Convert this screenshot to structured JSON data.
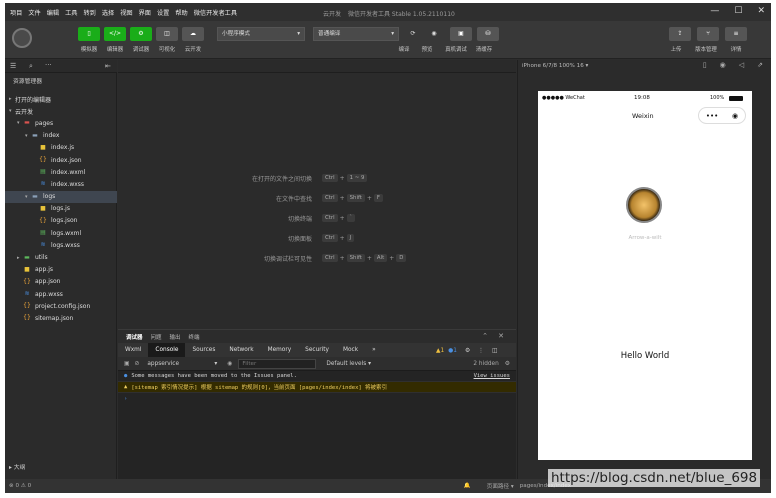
{
  "menu": [
    "项目",
    "文件",
    "编辑",
    "工具",
    "转到",
    "选择",
    "视图",
    "界面",
    "设置",
    "帮助",
    "微信开发者工具"
  ],
  "window_title": [
    "云开发",
    "微信开发者工具 Stable 1.05.2110110"
  ],
  "toolbar": {
    "mode_buttons": [
      "模拟器",
      "编辑器",
      "调试器",
      "可视化",
      "云开发"
    ],
    "compile_mode": "小程序模式",
    "compile_target": "普通编译",
    "actions": [
      "编译",
      "预览",
      "真机调试",
      "清缓存"
    ],
    "right_actions": [
      "上传",
      "版本管理",
      "详情"
    ]
  },
  "sidebar": {
    "header": "资源管理器",
    "sections": [
      "打开的编辑器",
      "云开发"
    ],
    "tree": [
      {
        "label": "pages",
        "indent": 1,
        "type": "folder-red",
        "caret": "▾"
      },
      {
        "label": "index",
        "indent": 2,
        "type": "folder",
        "caret": "▾"
      },
      {
        "label": "index.js",
        "indent": 3,
        "type": "js"
      },
      {
        "label": "index.json",
        "indent": 3,
        "type": "json"
      },
      {
        "label": "index.wxml",
        "indent": 3,
        "type": "wxml"
      },
      {
        "label": "index.wxss",
        "indent": 3,
        "type": "wxss"
      },
      {
        "label": "logs",
        "indent": 2,
        "type": "folder",
        "caret": "▾",
        "selected": true
      },
      {
        "label": "logs.js",
        "indent": 3,
        "type": "js"
      },
      {
        "label": "logs.json",
        "indent": 3,
        "type": "json"
      },
      {
        "label": "logs.wxml",
        "indent": 3,
        "type": "wxml"
      },
      {
        "label": "logs.wxss",
        "indent": 3,
        "type": "wxss"
      },
      {
        "label": "utils",
        "indent": 1,
        "type": "folder-green",
        "caret": "▸"
      },
      {
        "label": "app.js",
        "indent": 1,
        "type": "js"
      },
      {
        "label": "app.json",
        "indent": 1,
        "type": "json"
      },
      {
        "label": "app.wxss",
        "indent": 1,
        "type": "wxss"
      },
      {
        "label": "project.config.json",
        "indent": 1,
        "type": "json"
      },
      {
        "label": "sitemap.json",
        "indent": 1,
        "type": "json"
      }
    ],
    "outline": "大纲",
    "footer": "⊗ 0 ⚠ 0"
  },
  "editor_hints": [
    {
      "label": "在打开的文件之间切换",
      "keys": [
        "Ctrl",
        "1 ~ 9"
      ]
    },
    {
      "label": "在文件中查找",
      "keys": [
        "Ctrl",
        "Shift",
        "F"
      ]
    },
    {
      "label": "切换终端",
      "keys": [
        "Ctrl",
        "`"
      ]
    },
    {
      "label": "切换面板",
      "keys": [
        "Ctrl",
        "J"
      ]
    },
    {
      "label": "切换调试栏可见性",
      "keys": [
        "Ctrl",
        "Shift",
        "Alt",
        "D"
      ]
    }
  ],
  "console": {
    "panel_tabs": [
      "调试器",
      "问题",
      "输出",
      "终端"
    ],
    "devtools_tabs": [
      "Wxml",
      "Console",
      "Sources",
      "Network",
      "Memory",
      "Security",
      "Mock",
      "»"
    ],
    "active_tab": "Console",
    "badges": {
      "warnings": "1",
      "info": "1"
    },
    "context": "appservice",
    "filter_placeholder": "Filter",
    "levels": "Default levels ▾",
    "hidden": "2 hidden",
    "messages": [
      {
        "text": "Some messages have been moved to the Issues panel.",
        "link": "View issues",
        "kind": "info"
      },
      {
        "text": "[sitemap 索引情况提示] 根据 sitemap 的规则[0]，当前页面 [pages/index/index] 将被索引",
        "kind": "warn"
      }
    ],
    "prompt": "›"
  },
  "simulator": {
    "device": "iPhone 6/7/8 100% 16 ▾",
    "carrier": "●●●●● WeChat",
    "time": "19:08",
    "battery": "100%",
    "nav_title": "Weixin",
    "username": "Arrow-a-wilt",
    "body_text": "Hello World"
  },
  "statusbar": {
    "left": "页面路径 ▾",
    "path": "pages/index/index"
  },
  "watermark": "https://blog.csdn.net/blue_698",
  "colors": {
    "accent_green": "#1aad19",
    "warn_bg": "#332b00",
    "warn_text": "#f0d060"
  }
}
